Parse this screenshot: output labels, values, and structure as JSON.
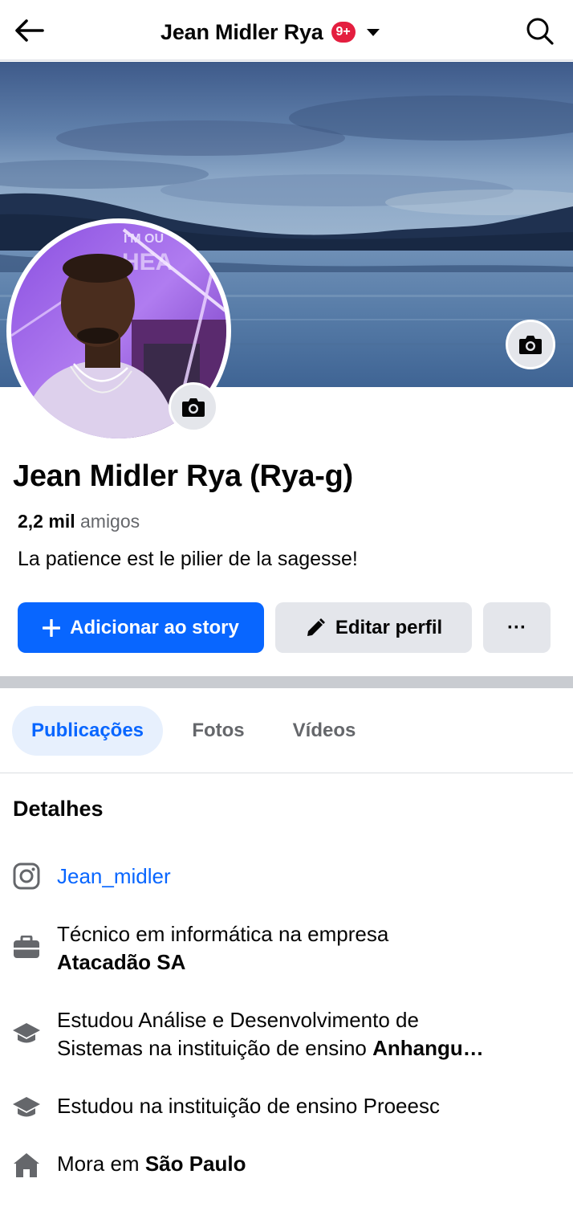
{
  "header": {
    "title": "Jean Midler Rya",
    "notification_badge": "9+",
    "back_icon": "arrow-left-icon",
    "search_icon": "search-icon"
  },
  "profile": {
    "name": "Jean Midler Rya (Rya-g)",
    "friends_count": "2,2 mil",
    "friends_label": "amigos",
    "bio": "La patience est le pilier de la sagesse!",
    "cover_banner_text": "I'M OU",
    "cover_banner_text2": "HEA"
  },
  "actions": {
    "add_story": "Adicionar ao story",
    "edit_profile": "Editar perfil",
    "more": "···"
  },
  "tabs": [
    {
      "label": "Publicações",
      "active": true
    },
    {
      "label": "Fotos",
      "active": false
    },
    {
      "label": "Vídeos",
      "active": false
    }
  ],
  "details": {
    "title": "Detalhes",
    "instagram": "Jean_midler",
    "work_prefix": "Técnico em informática na empresa",
    "work_company": "Atacadão SA",
    "study1_line1": "Estudou Análise e Desenvolvimento de",
    "study1_line2_prefix": "Sistemas na instituição de ensino",
    "study1_school": "Anhangu…",
    "study2": "Estudou na instituição de ensino Proeesc",
    "lives_prefix": "Mora em",
    "lives_city": "São Paulo"
  },
  "colors": {
    "brand_blue": "#0866ff",
    "badge_red": "#e41e3f",
    "tab_active_bg": "#e7f0fd",
    "button_gray": "#e4e6eb"
  }
}
